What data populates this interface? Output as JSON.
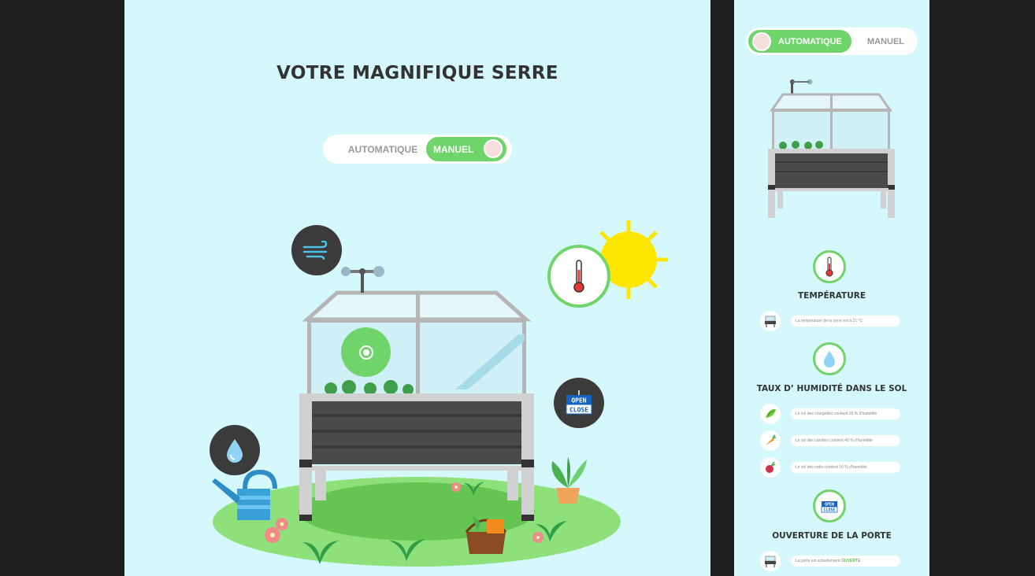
{
  "main": {
    "title": "VOTRE MAGNIFIQUE SERRE",
    "mode_toggle": {
      "option_auto": "AUTOMATIQUE",
      "option_manual": "MANUEL",
      "selected": "MANUEL"
    },
    "door_sign": {
      "line1": "OPEN",
      "line2": "CLOSE"
    }
  },
  "side": {
    "mode_toggle": {
      "option_auto": "AUTOMATIQUE",
      "option_manual": "MANUEL",
      "selected": "AUTOMATIQUE"
    },
    "temperature": {
      "title": "TEMPÉRATURE",
      "message": "La temperature de la serre est à 21 °C"
    },
    "humidity": {
      "title": "TAUX D’ HUMIDITÉ DANS LE SOL",
      "rows": [
        {
          "icon": "zucchini-icon",
          "message": "Le sol des courgettes contient 20 % d'humidite"
        },
        {
          "icon": "carrot-icon",
          "message": "Le sol des carottes contient 40 % d'humidite"
        },
        {
          "icon": "radish-icon",
          "message": "Le sol des radis contient 10 % d'humidite"
        }
      ]
    },
    "door": {
      "title": "OUVERTURE DE LA PORTE",
      "message": "La porte est actuellement",
      "state": "OUVERTE",
      "sign_line1": "OPEN",
      "sign_line2": "CLOSE"
    }
  },
  "colors": {
    "background": "#d4f8fb",
    "accent_green": "#6fd56a",
    "dark_circle": "#3b3b3b",
    "page_outer": "#1e1e1e"
  }
}
